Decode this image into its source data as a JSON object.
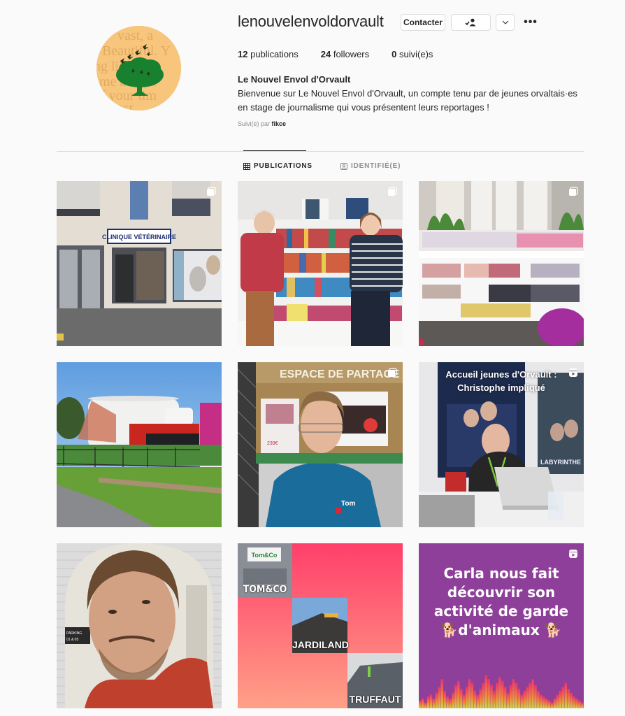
{
  "profile": {
    "username": "lenouvelenvoldorvault",
    "full_name": "Le Nouvel Envol d'Orvault",
    "bio": "Bienvenue sur Le Nouvel Envol d'Orvault, un compte tenu par de jeunes orvaltais·es en stage de journalisme qui vous présentent leurs reportages !",
    "followed_by_label": "Suivi(e) par",
    "followed_by_user": "fikce",
    "avatar_icon": "tree-with-birds-logo"
  },
  "actions": {
    "contact_label": "Contacter",
    "following_icon": "person-check-icon",
    "chevron_icon": "chevron-down-icon",
    "more_icon": "ellipsis-icon",
    "more_glyph": "•••"
  },
  "stats": [
    {
      "count": "12",
      "label": "publications"
    },
    {
      "count": "24",
      "label": "followers"
    },
    {
      "count": "0",
      "label": "suivi(e)s"
    }
  ],
  "tabs": [
    {
      "label": "PUBLICATIONS",
      "icon": "grid-icon",
      "active": true
    },
    {
      "label": "IDENTIFIÉ(E)",
      "icon": "tagged-icon",
      "active": false
    }
  ],
  "posts": [
    {
      "description": "Clinique vétérinaire storefront",
      "sign_text": "CLINIQUE VÉTÉRINAIRE",
      "type": "carousel"
    },
    {
      "description": "Two women in a library in front of bookshelves",
      "type": "carousel"
    },
    {
      "description": "Library manga shelves",
      "type": "carousel"
    },
    {
      "description": "Round white building with red wing and pink sign",
      "type": "image"
    },
    {
      "description": "Young man in blue Tom&Co polo",
      "type": "carousel"
    },
    {
      "description": "Man at laptop in front of movie posters",
      "overlay_line1": "Accueil jeunes d'Orvault :",
      "overlay_line2": "Christophe impliqué",
      "type": "reel"
    },
    {
      "description": "Smiling man in red hoodie, arched frame on brick wall",
      "type": "image"
    },
    {
      "description": "Pet store collage",
      "labels": [
        "TOM&CO",
        "JARDILAND",
        "TRUFFAUT"
      ],
      "type": "image"
    },
    {
      "description": "Purple reel card with audio waveform",
      "overlay_lines": [
        "Carla nous fait",
        "découvrir son",
        "activité de garde",
        "🐕d'animaux 🐕"
      ],
      "type": "reel"
    }
  ],
  "colors": {
    "background": "#fafafa",
    "text": "#262626",
    "muted": "#8e8e8e",
    "border": "#dbdbdb",
    "reel_purple": "#8e3f99",
    "collage_pink": "#ff4d6d"
  }
}
